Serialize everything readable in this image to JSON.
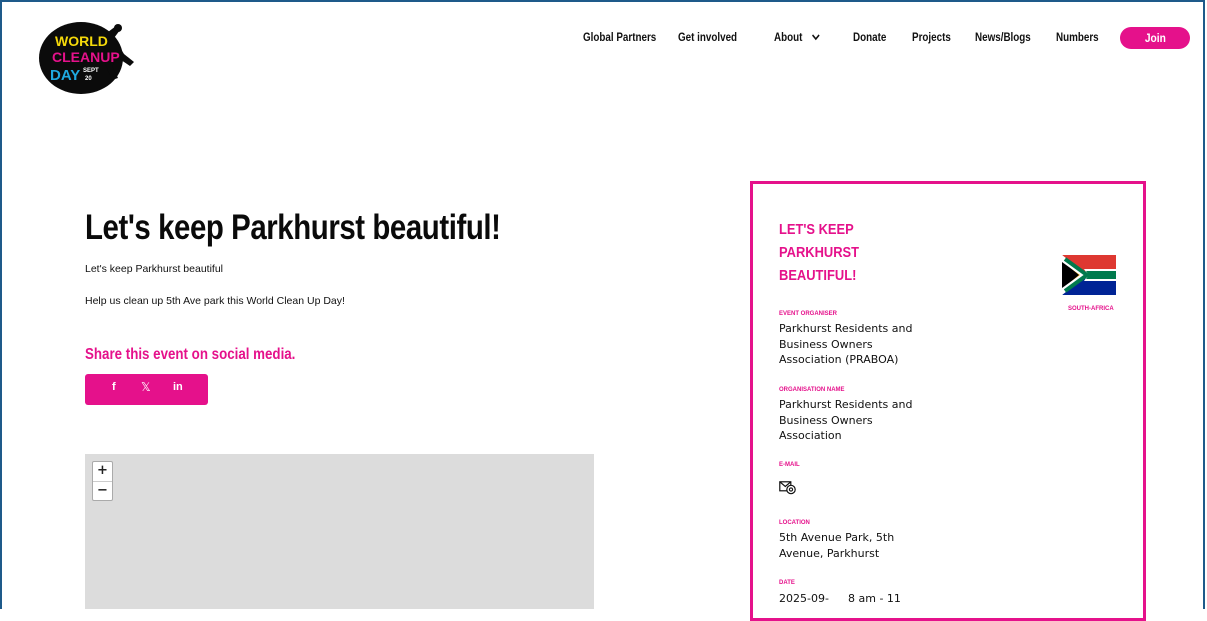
{
  "logo": {
    "line1": "WORLD",
    "line2": "CLEANUP",
    "line3": "DAY",
    "badge": "SEPT",
    "badge_num": "20"
  },
  "nav": {
    "items": [
      "Global Partners",
      "Get involved",
      "About",
      "Donate",
      "Projects",
      "News/Blogs",
      "Numbers"
    ],
    "join": "Join"
  },
  "event": {
    "title": "Let's keep Parkhurst beautiful!",
    "subtitle": "Let's keep Parkhurst beautiful",
    "description": "Help us clean up 5th Ave park this World Clean Up Day!",
    "share_title": "Share this event on social media.",
    "share_icons": [
      "f",
      "𝕏",
      "in"
    ]
  },
  "map": {
    "zoom_in": "+",
    "zoom_out": "−"
  },
  "card": {
    "title": "LET'S KEEP PARKHURST BEAUTIFUL!",
    "country": "SOUTH-AFRICA",
    "organiser_label": "EVENT ORGANISER",
    "organiser": "Parkhurst Residents and Business Owners Association (PRABOA)",
    "orgname_label": "ORGANISATION NAME",
    "orgname": "Parkhurst Residents and Business Owners Association",
    "email_label": "E-MAIL",
    "location_label": "LOCATION",
    "location": "5th Avenue Park, 5th Avenue, Parkhurst",
    "date_label": "DATE",
    "date": "2025-09-",
    "time": "8 am - 11"
  },
  "colors": {
    "accent": "#e5118b",
    "frame": "#1e5a8a"
  }
}
